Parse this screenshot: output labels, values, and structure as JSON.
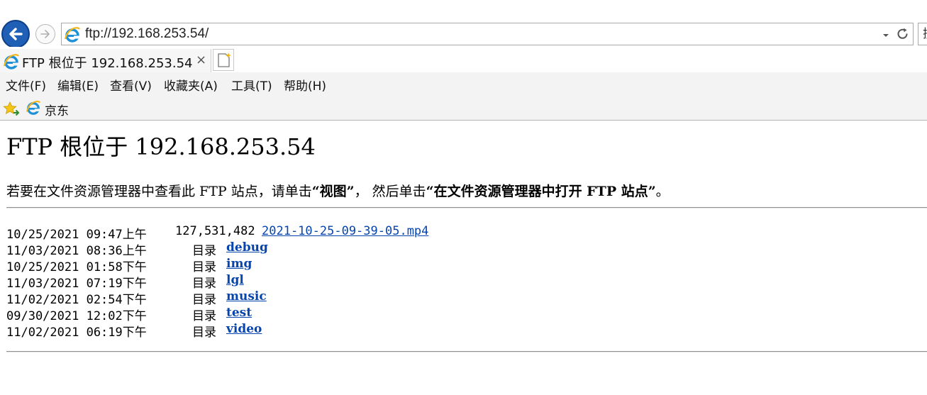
{
  "browser": {
    "address_url": "ftp://192.168.253.54/",
    "search_partial": "搜",
    "tab_title": "FTP 根位于 192.168.253.54",
    "tab_close": "×",
    "menu": [
      "文件(F)",
      "编辑(E)",
      "查看(V)",
      "收藏夹(A)",
      "工具(T)",
      "帮助(H)"
    ],
    "favorites": [
      {
        "label": "京东"
      }
    ]
  },
  "page": {
    "title": "FTP 根位于 192.168.253.54",
    "instructions": {
      "part1": "若要在文件资源管理器中查看此 FTP 站点，请单击",
      "bold1": "“视图”",
      "part2": "， 然后单击",
      "bold2": "“在文件资源管理器中打开 FTP 站点”",
      "part3": "。"
    },
    "entries": [
      {
        "date": "10/25/2021 09:47上午",
        "size": "127,531,482",
        "name": "2021-10-25-09-39-05.mp4",
        "type": "file"
      },
      {
        "date": "11/03/2021 08:36上午",
        "size": "目录",
        "name": "debug",
        "type": "dir"
      },
      {
        "date": "10/25/2021 01:58下午",
        "size": "目录",
        "name": "img",
        "type": "dir"
      },
      {
        "date": "11/03/2021 07:19下午",
        "size": "目录",
        "name": "lgl",
        "type": "dir"
      },
      {
        "date": "11/02/2021 02:54下午",
        "size": "目录",
        "name": "music",
        "type": "dir"
      },
      {
        "date": "09/30/2021 12:02下午",
        "size": "目录",
        "name": "test",
        "type": "dir"
      },
      {
        "date": "11/02/2021 06:19下午",
        "size": "目录",
        "name": "video",
        "type": "dir"
      }
    ]
  },
  "colors": {
    "back_button": "#1f5fb6",
    "link": "#0645ad",
    "ie_blue": "#1e90d8",
    "star": "#f5c518"
  },
  "icons": [
    "back-arrow-icon",
    "forward-arrow-icon",
    "ie-logo-icon",
    "dropdown-icon",
    "refresh-icon",
    "new-tab-icon",
    "favorites-star-icon"
  ]
}
